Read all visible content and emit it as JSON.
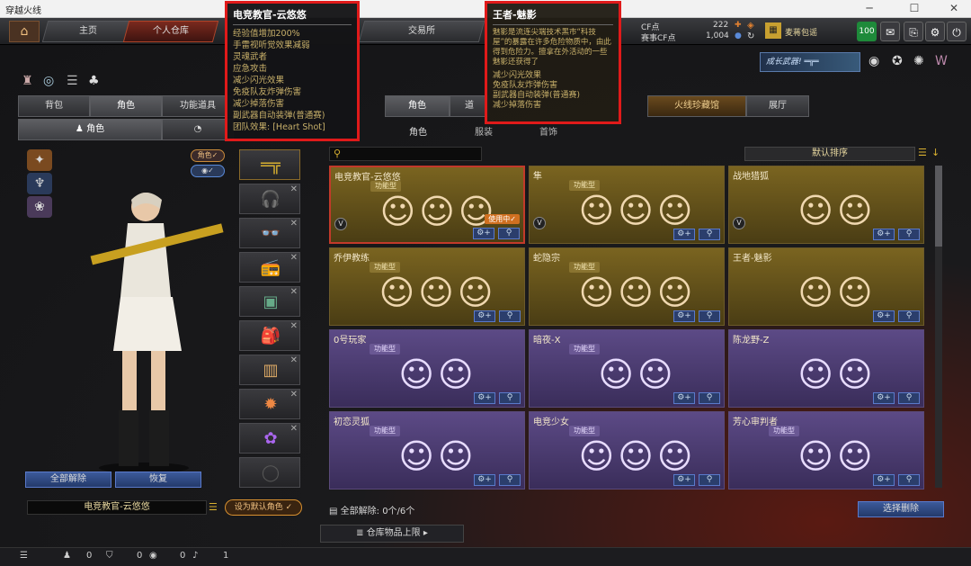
{
  "window": {
    "title": "穿越火线"
  },
  "nav": {
    "tabs": [
      "主页",
      "个人仓库",
      "交易所"
    ]
  },
  "currency": {
    "cf_label": "CF点",
    "cf_value": "222",
    "game_label": "赛事CF点",
    "game_value": "1,004",
    "gift_label": "麦蒋包谣",
    "level": "100"
  },
  "promo": {
    "label": "成长武器!"
  },
  "left": {
    "tabs": [
      "背包",
      "角色",
      "功能道具"
    ],
    "subtab": "角色",
    "role_toggle": "角色",
    "release_all": "全部解除",
    "restore": "恢复",
    "current_character": "电竞教官-云悠悠",
    "set_default": "设为默认角色"
  },
  "right": {
    "tabs": [
      "角色",
      "火线珍藏馆",
      "展厅"
    ],
    "subtabs": [
      "角色",
      "服装",
      "首饰"
    ],
    "sort_label": "默认排序",
    "footer_release": "全部解除: 0个/6个",
    "select_release": "选择删除",
    "warehouse_limit": "仓库物品上限"
  },
  "cards": [
    {
      "name": "电竞教官-云悠悠",
      "tag": "功能型",
      "theme": "gold",
      "selected": true,
      "in_use": "使用中✓",
      "figs": 3
    },
    {
      "name": "隼",
      "tag": "功能型",
      "theme": "gold",
      "figs": 3
    },
    {
      "name": "战地猎狐",
      "tag": "",
      "theme": "gold",
      "figs": 2
    },
    {
      "name": "乔伊教练",
      "tag": "功能型",
      "theme": "gold",
      "figs": 3
    },
    {
      "name": "蛇隐宗",
      "tag": "功能型",
      "theme": "gold",
      "figs": 3
    },
    {
      "name": "王者-魅影",
      "tag": "",
      "theme": "gold",
      "figs": 2
    },
    {
      "name": "0号玩家",
      "tag": "功能型",
      "theme": "purple",
      "figs": 2
    },
    {
      "name": "暗夜-X",
      "tag": "功能型",
      "theme": "purple",
      "figs": 2
    },
    {
      "name": "陈龙野-Z",
      "tag": "",
      "theme": "purple",
      "figs": 2
    },
    {
      "name": "初恋灵狐",
      "tag": "功能型",
      "theme": "purple",
      "figs": 2
    },
    {
      "name": "电竞少女",
      "tag": "功能型",
      "theme": "purple",
      "figs": 3
    },
    {
      "name": "芳心审判者",
      "tag": "功能型",
      "theme": "purple",
      "figs": 2
    }
  ],
  "tooltip1": {
    "title": "电竞教官-云悠悠",
    "lines": [
      "经验值增加200%",
      "手雷视听觉效果减弱",
      "灵魂武者",
      "应急攻击",
      "减少闪光效果",
      "免疫队友炸弹伤害",
      "减少掉落伤害",
      "副武器自动装弹(普通赛)",
      "团队效果: [Heart Shot]"
    ]
  },
  "tooltip2": {
    "title": "王者-魅影",
    "desc": "魅影是流连尖端技术黑市“科技屋”的暴露在许多危险物质中，由此得到危险力。擅拿在外活动的一些魅影还获得了",
    "lines": [
      "减少闪光效果",
      "免疫队友炸弹伤害",
      "副武器自动装弹(普通赛)",
      "减少掉落伤害"
    ]
  },
  "statusbar": {
    "items": [
      "0",
      "0",
      "0",
      "1"
    ]
  }
}
